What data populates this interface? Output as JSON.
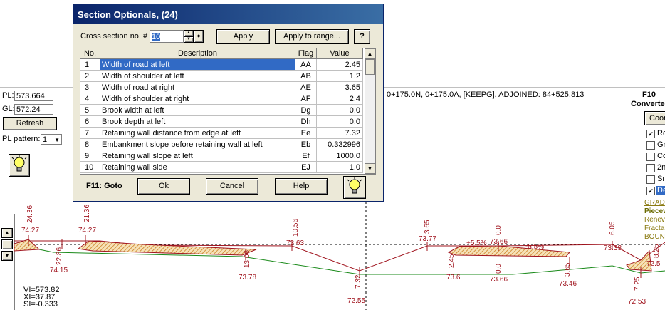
{
  "dialog": {
    "title": "Section Optionals, (24)",
    "cross_section_label": "Cross section no. #",
    "cross_section_value": "10",
    "apply_label": "Apply",
    "apply_range_label": "Apply to range...",
    "help_q_label": "?",
    "goto_hint": "F11: Goto",
    "ok_label": "Ok",
    "cancel_label": "Cancel",
    "help_label": "Help",
    "columns": [
      "No.",
      "Description",
      "Flag",
      "Value"
    ],
    "rows": [
      {
        "no": "1",
        "desc": "Width of road at left",
        "flag": "AA",
        "value": "2.45"
      },
      {
        "no": "2",
        "desc": "Width of shoulder at left",
        "flag": "AB",
        "value": "1.2"
      },
      {
        "no": "3",
        "desc": "Width of road at right",
        "flag": "AE",
        "value": "3.65"
      },
      {
        "no": "4",
        "desc": "Width of shoulder at right",
        "flag": "AF",
        "value": "2.4"
      },
      {
        "no": "5",
        "desc": "Brook width at left",
        "flag": "Dg",
        "value": "0.0"
      },
      {
        "no": "6",
        "desc": "Brook depth at left",
        "flag": "Dh",
        "value": "0.0"
      },
      {
        "no": "7",
        "desc": "Retaining wall distance from edge at left",
        "flag": "Ee",
        "value": "7.32"
      },
      {
        "no": "8",
        "desc": "Embankment slope before retaining wall at left",
        "flag": "Eb",
        "value": "0.332996"
      },
      {
        "no": "9",
        "desc": "Retaining wall slope at left",
        "flag": "Ef",
        "value": "1000.0"
      },
      {
        "no": "10",
        "desc": "Retaining wall side",
        "flag": "EJ",
        "value": "1.0"
      }
    ]
  },
  "app": {
    "pl_label": "PL:",
    "pl_value": "573.664",
    "gl_label": "GL:",
    "gl_value": "572.24",
    "refresh_label": "Refresh",
    "pl_pattern_label": "PL pattern:",
    "pl_pattern_value": "1",
    "status": "0+175.0N, 0+175.0A, [KEEPG], ADJOINED: 84+525.813",
    "f10_label": "F10",
    "convert_label": "Converte",
    "coord_btn_label": "Coor",
    "checkboxes": [
      {
        "label": "Ro",
        "checked": true
      },
      {
        "label": "Gr",
        "checked": false
      },
      {
        "label": "Co",
        "checked": false
      },
      {
        "label": "2n",
        "checked": false
      },
      {
        "label": "Sn",
        "checked": false
      },
      {
        "label": "De",
        "checked": true
      }
    ],
    "legend": [
      "GRAD",
      "Piecev",
      "Renev",
      "Fracta",
      "BOUN"
    ],
    "readout": [
      "VI=573.82",
      "XI=37.87",
      "SI=-0.333"
    ]
  },
  "drawing": {
    "labels": [
      "24.36",
      "74.27",
      "21.36",
      "74.27",
      "22.86",
      "74.15",
      "13.06",
      "73.78",
      "10.56",
      "73.63",
      "7.32",
      "72.55",
      "3.65",
      "73.77",
      "+5.5%",
      "0.0",
      "73.66",
      "-5.5%",
      "6.05",
      "73.33",
      "2.45",
      "73.6",
      "0.0",
      "73.66",
      "3.65",
      "73.46",
      "7.25",
      "72.53",
      "8.25",
      "72.5"
    ]
  },
  "colors": {
    "accent": "#0a246a",
    "selection": "#316ac5",
    "drawing_red": "#a0141e",
    "drawing_green": "#1a8a1a",
    "hatch": "#e0a040"
  }
}
